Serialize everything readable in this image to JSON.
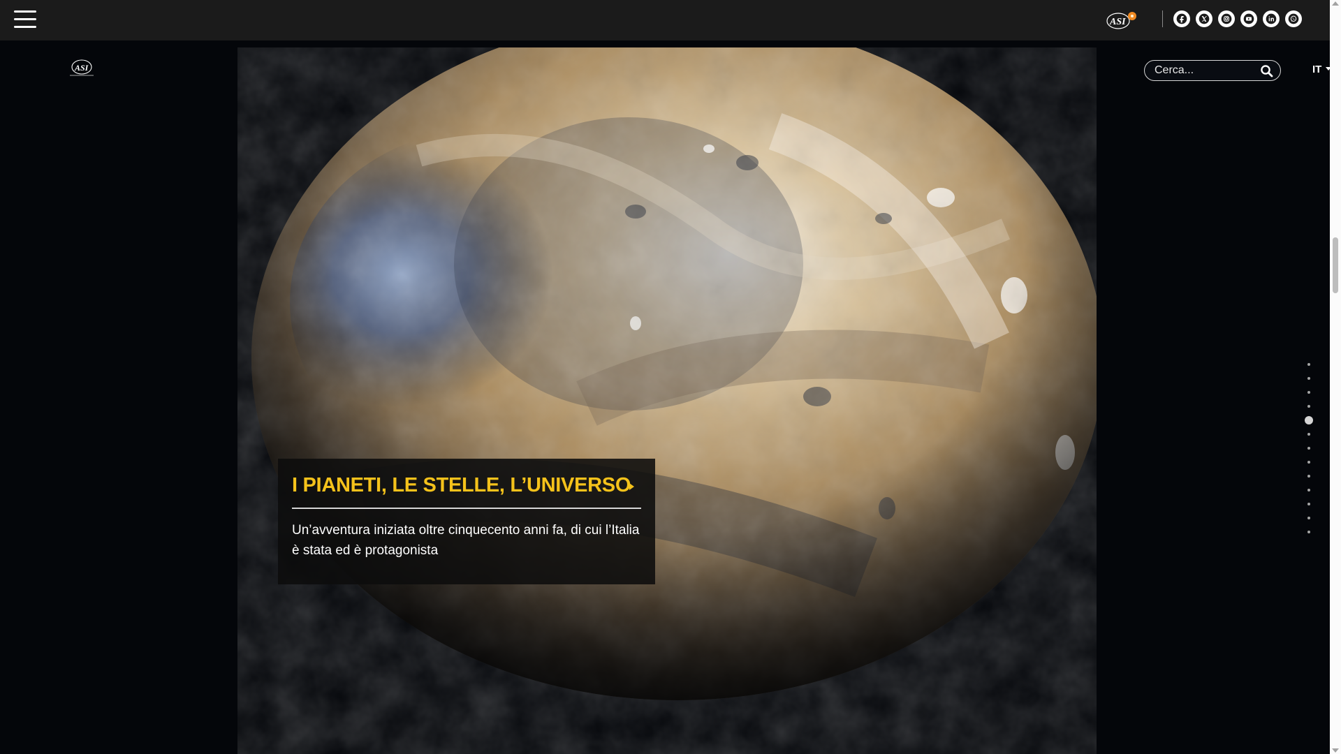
{
  "header": {
    "menu_icon": "hamburger-menu-icon",
    "logo": "asi-logo",
    "social": [
      {
        "name": "facebook-icon"
      },
      {
        "name": "x-twitter-icon"
      },
      {
        "name": "instagram-icon"
      },
      {
        "name": "youtube-icon"
      },
      {
        "name": "linkedin-icon"
      },
      {
        "name": "whatsapp-icon"
      }
    ]
  },
  "search": {
    "placeholder": "Cerca...",
    "icon": "search-icon"
  },
  "language": {
    "selected": "IT"
  },
  "hero": {
    "title": "I PIANETI, LE STELLE, L’UNIVERSO",
    "description": "Un’avventura iniziata oltre cinquecento anni fa, di cui l’Italia è stata ed è protagonista",
    "accent_color": "#f5c21b"
  },
  "pagination": {
    "total": 13,
    "active": 5
  }
}
